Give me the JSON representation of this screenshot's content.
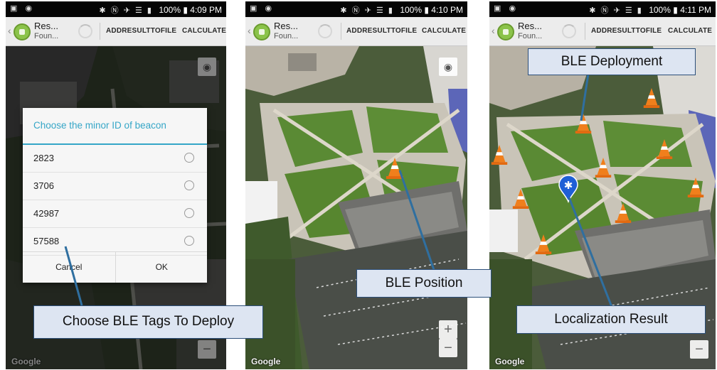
{
  "screens": [
    {
      "status": {
        "icons": "✱ Ⓝ ✈ ☰ ▮",
        "battery": "100%",
        "time": "4:09 PM"
      },
      "app_title": "Res...",
      "app_subtitle": "Foun...",
      "buttons": [
        "ADDRESULTTOFILE",
        "CALCULATE"
      ],
      "dialog": {
        "title": "Choose the minor ID of beacon",
        "options": [
          "2823",
          "3706",
          "42987",
          "57588"
        ],
        "cancel": "Cancel",
        "ok": "OK"
      },
      "map_credit": "Google"
    },
    {
      "status": {
        "icons": "✱ Ⓝ ✈ ☰ ▮",
        "battery": "100%",
        "time": "4:10 PM"
      },
      "app_title": "Res...",
      "app_subtitle": "Foun...",
      "buttons": [
        "ADDRESULTTOFILE",
        "CALCULATE"
      ],
      "map_credit": "Google"
    },
    {
      "status": {
        "icons": "✱ Ⓝ ✈ ☰ ▮",
        "battery": "100%",
        "time": "4:11 PM"
      },
      "app_title": "Res...",
      "app_subtitle": "Foun...",
      "buttons": [
        "ADDRESULTTOFILE",
        "CALCULATE"
      ],
      "map_credit": "Google"
    }
  ],
  "annotations": {
    "choose_tags": "Choose BLE Tags To Deploy",
    "ble_position": "BLE Position",
    "ble_deployment": "BLE Deployment",
    "localization_result": "Localization Result"
  },
  "colors": {
    "dialog_accent": "#35a6c7",
    "callout_fill": "#dde5f2",
    "callout_border": "#2c4f7a",
    "cone_orange": "#f07f1c",
    "marker_blue": "#1f5fd6"
  },
  "icons": [
    "back-chevron-icon",
    "android-app-icon",
    "my-location-icon",
    "zoom-in-icon",
    "zoom-out-icon",
    "traffic-cone-icon",
    "star-of-life-marker-icon"
  ]
}
